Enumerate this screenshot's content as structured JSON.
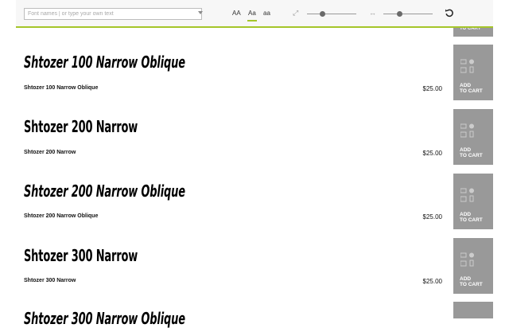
{
  "toolbar": {
    "search_placeholder": "Font names | or type your own text",
    "case_upper": "AA",
    "case_title": "Aa",
    "case_lower": "aa",
    "active_case": "Aa",
    "size_icon": "expand-diagonal-icon",
    "spacing_icon": "horizontal-arrows-icon",
    "size_level": 0.32,
    "spacing_level": 0.32,
    "reset_icon": "undo-icon",
    "accent_color": "#a5c52a"
  },
  "top_partial_cart": {
    "label": "TO CART"
  },
  "fonts": [
    {
      "specimen": "Shtozer 100 Narrow Oblique",
      "name": "Shtozer 100 Narrow Oblique",
      "price": "$25.00",
      "cart_line1": "ADD",
      "cart_line2": "TO CART"
    },
    {
      "specimen": "Shtozer 200 Narrow",
      "name": "Shtozer 200 Narrow",
      "price": "$25.00",
      "cart_line1": "ADD",
      "cart_line2": "TO CART"
    },
    {
      "specimen": "Shtozer 200 Narrow Oblique",
      "name": "Shtozer 200 Narrow Oblique",
      "price": "$25.00",
      "cart_line1": "ADD",
      "cart_line2": "TO CART"
    },
    {
      "specimen": "Shtozer 300 Narrow",
      "name": "Shtozer 300 Narrow",
      "price": "$25.00",
      "cart_line1": "ADD",
      "cart_line2": "TO CART"
    },
    {
      "specimen": "Shtozer 300 Narrow Oblique",
      "name": "",
      "price": "",
      "cart_line1": "",
      "cart_line2": ""
    }
  ]
}
